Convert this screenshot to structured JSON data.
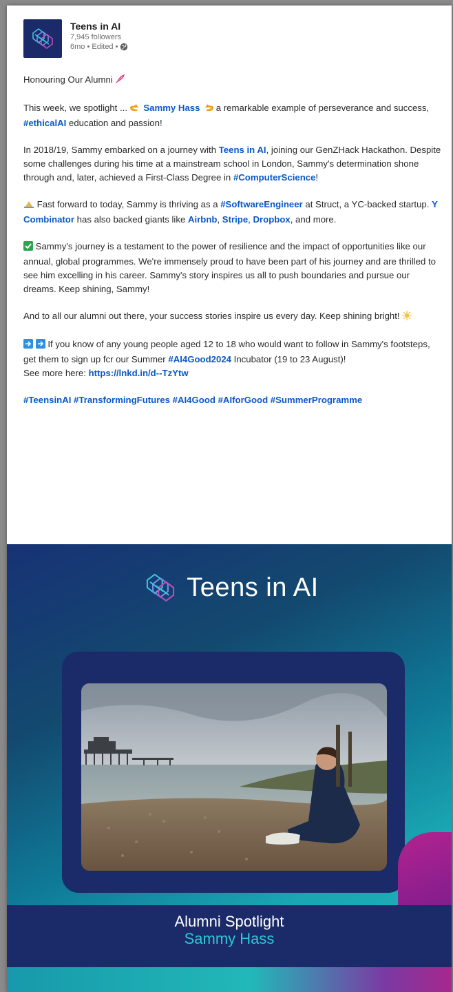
{
  "header": {
    "org_name": "Teens in AI",
    "followers": "7,945 followers",
    "meta": "6mo • Edited •",
    "icons": [
      "teens-in-ai-logo",
      "globe-icon"
    ]
  },
  "post": {
    "title": "Honouring Our Alumni",
    "p1": {
      "a": "This week, we spotlight ...",
      "mention": "Sammy Hass",
      "b": "a remarkable example of perseverance and success,",
      "hashtag": "#ethicalAI",
      "c": "education and passion!"
    },
    "p2": {
      "a": "In 2018/19, Sammy embarked on a journey with",
      "mention": "Teens in AI",
      "b": ", joining our GenZHack Hackathon. Despite some challenges during his time at a mainstream school in London, Sammy's determination shone through and, later, achieved a First-Class Degree in",
      "hashtag": "#ComputerScience",
      "c": "!"
    },
    "p3": {
      "a": "Fast forward to today, Sammy is thriving as a",
      "hashtag": "#SoftwareEngineer",
      "b": "at Struct, a YC-backed startup.",
      "yc": "Y Combinator",
      "c": "has also backed giants like",
      "airbnb": "Airbnb",
      "stripe": "Stripe",
      "dropbox": "Dropbox",
      "d": ", and more."
    },
    "p4": "Sammy's journey is a testament to the power of resilience and the impact of opportunities like our annual, global programmes. We're immensely proud to have been part of his journey and are thrilled to see him excelling in his career. Sammy's story inspires us all to push boundaries and pursue our dreams. Keep shining, Sammy!",
    "p5": "And to all our alumni out there, your success stories inspire us every day. Keep shining bright!",
    "p6": {
      "a": "If you know of any young people aged 12 to 18 who would want to follow in Sammy's footsteps, get them to sign up fcr our Summer",
      "hashtag": "#AI4Good2024",
      "b": "Incubator (19 to 23 August)!",
      "see_more": "See more here:",
      "link": "https://lnkd.in/d--TzYtw"
    },
    "hashtags": "#TeensinAI #TransformingFutures #AI4Good #AIforGood #SummerProgramme"
  },
  "banner": {
    "brand": "Teens in AI",
    "spotlight": "Alumni Spotlight",
    "name": "Sammy Hass",
    "colors": {
      "navy": "#1b2a68",
      "teal": "#20b8b8",
      "cyan_text": "#2ec9d6",
      "magenta": "#b3238f"
    }
  }
}
